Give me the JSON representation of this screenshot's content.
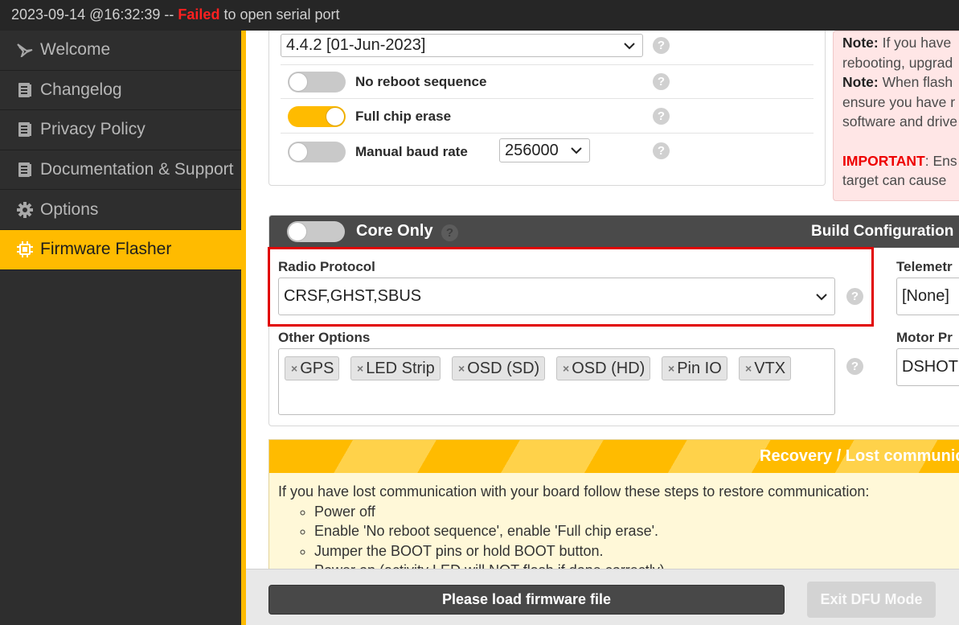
{
  "status": {
    "timestamp": "2023-09-14 @16:32:39 --",
    "failed": "Failed",
    "message": "to open serial port"
  },
  "sidebar": {
    "items": [
      {
        "label": "Welcome",
        "icon": "wing-icon"
      },
      {
        "label": "Changelog",
        "icon": "document-icon"
      },
      {
        "label": "Privacy Policy",
        "icon": "document-icon"
      },
      {
        "label": "Documentation & Support",
        "icon": "document-icon"
      },
      {
        "label": "Options",
        "icon": "gear-icon"
      },
      {
        "label": "Firmware Flasher",
        "icon": "chip-icon",
        "active": true
      }
    ]
  },
  "flash_options": {
    "version_select": "4.4.2 [01-Jun-2023]",
    "no_reboot": {
      "label": "No reboot sequence",
      "on": false
    },
    "full_chip_erase": {
      "label": "Full chip erase",
      "on": true
    },
    "manual_baud": {
      "label": "Manual baud rate",
      "on": false,
      "value": "256000"
    },
    "help": "?"
  },
  "notes": {
    "note1_label": "Note:",
    "note1_line1": "If you have",
    "note1_line2": "rebooting, upgrad",
    "note2_label": "Note:",
    "note2_line1": "When flash",
    "note2_line2": "ensure you have r",
    "note2_line3": "software and drive",
    "important_label": "IMPORTANT",
    "important_line1": ": Ens",
    "important_line2": "target can cause"
  },
  "build": {
    "core_only_label": "Core Only",
    "core_only_on": false,
    "header_title": "Build Configuration",
    "radio_protocol_label": "Radio Protocol",
    "radio_protocol_value": "CRSF,GHST,SBUS",
    "telemetry_label": "Telemetr",
    "telemetry_value": "[None]",
    "other_options_label": "Other Options",
    "other_options": [
      "GPS",
      "LED Strip",
      "OSD (SD)",
      "OSD (HD)",
      "Pin IO",
      "VTX"
    ],
    "motor_protocol_label": "Motor Pr",
    "motor_protocol_value": "DSHOT"
  },
  "recovery": {
    "title": "Recovery / Lost communic",
    "intro": "If you have lost communication with your board follow these steps to restore communication:",
    "steps": [
      "Power off",
      "Enable 'No reboot sequence', enable 'Full chip erase'.",
      "Jumper the BOOT pins or hold BOOT button.",
      "Power on (activity LED will NOT flash if done correctly)."
    ]
  },
  "buttons": {
    "load_firmware": "Please load firmware file",
    "exit_dfu": "Exit DFU Mode"
  },
  "colors": {
    "accent": "#ffbb00",
    "failed": "#ff2020",
    "highlight": "#e10000"
  }
}
